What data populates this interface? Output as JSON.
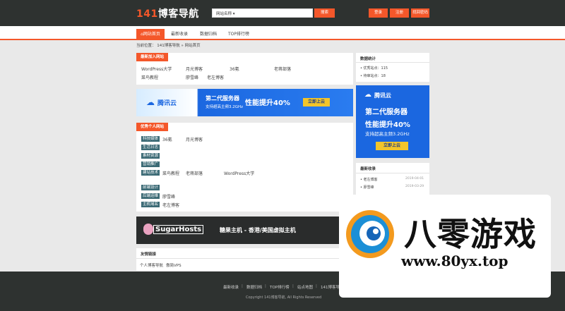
{
  "header": {
    "logo_num": "141",
    "logo_text": "博客导航",
    "search_type": "网站名称 ▾",
    "search_button": "搜索",
    "buttons": [
      "登录",
      "注册",
      "找回密码"
    ]
  },
  "nav": {
    "items": [
      "网站首页",
      "最新收录",
      "数据归档",
      "TOP排行榜"
    ]
  },
  "breadcrumb": "当前位置： 141博客导航 » 网站首页",
  "latest_sites": {
    "title": "最新加入网站",
    "links": [
      "WordPress大学",
      "月光博客",
      "36氪",
      "老蒋部落",
      "菜鸟教程",
      "廖雪峰",
      "老左博客"
    ]
  },
  "tencent_banner": {
    "brand": "腾讯云",
    "headline": "第二代服务器",
    "sub": "支持超高主频3.2GHz",
    "perf": "性能提升40%",
    "cta": "立即上云"
  },
  "quality_sites": {
    "title": "优秀个人网站",
    "rows": [
      {
        "tag": "科技媒体",
        "links": [
          "36氪",
          "月光博客"
        ]
      },
      {
        "tag": "生活日志",
        "links": []
      },
      {
        "tag": "素材资源",
        "links": []
      },
      {
        "tag": "营销推广",
        "links": []
      },
      {
        "tag": "建站技术",
        "links": [
          "菜鸟教程",
          "老蒋部落",
          "WordPress大学"
        ]
      },
      {
        "tag": "前端设计",
        "links": []
      },
      {
        "tag": "后端运维",
        "links": [
          "廖雪峰"
        ]
      },
      {
        "tag": "主机域名",
        "links": [
          "老左博客"
        ]
      }
    ]
  },
  "sugar_banner": {
    "brand": "SugarHosts",
    "text": "糖果主机 - 香港/美国虚拟主机"
  },
  "friend_links": {
    "title": "友情链接",
    "links": [
      "个人博客导航",
      "傲简VPS"
    ]
  },
  "sidebar": {
    "stats_title": "数据统计",
    "stats": [
      "优秀站点：115",
      "待审站点：18"
    ],
    "recent_title": "最新收录",
    "recent": [
      {
        "name": "老左博客",
        "date": "2019-04-01"
      },
      {
        "name": "廖雪峰",
        "date": "2019-03-29"
      }
    ]
  },
  "footer": {
    "links": [
      "最新收录",
      "数据归档",
      "TOP排行榜",
      "站点地图",
      "141博客导航"
    ],
    "copyright": "Copyright 141博客导航, All Rights Reserved"
  },
  "watermark": {
    "title": "八零游戏",
    "url": "www.80yx.top"
  },
  "colors": {
    "accent": "#f4572a",
    "header_bg": "#2e3230",
    "tag_bg": "#3b6a75",
    "tencent_blue": "#1b67e0"
  }
}
